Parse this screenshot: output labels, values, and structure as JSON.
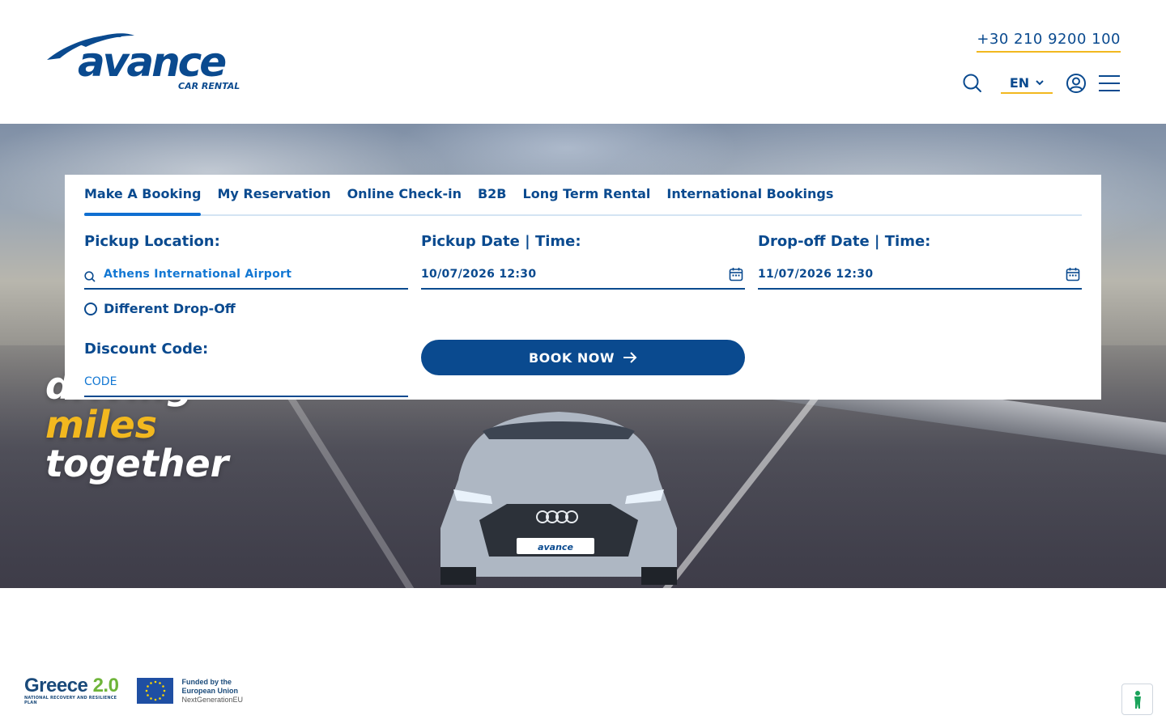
{
  "header": {
    "logo_text": "avance",
    "logo_subtitle": "CAR RENTAL",
    "phone": "+30 210 9200 100",
    "language": "EN"
  },
  "hero": {
    "slogan_line1": "driving",
    "slogan_line2": "miles",
    "slogan_line3": "together",
    "plate_text": "avance"
  },
  "booking": {
    "tabs": [
      {
        "label": "Make A Booking",
        "active": true
      },
      {
        "label": "My Reservation",
        "active": false
      },
      {
        "label": "Online Check-in",
        "active": false
      },
      {
        "label": "B2B",
        "active": false
      },
      {
        "label": "Long Term Rental",
        "active": false
      },
      {
        "label": "International Bookings",
        "active": false
      }
    ],
    "pickup_location_label": "Pickup Location:",
    "pickup_location_value": "Athens International Airport",
    "different_dropoff_label": "Different Drop-Off",
    "discount_label": "Discount Code:",
    "discount_placeholder": "CODE",
    "pickup_date_label": "Pickup Date | Time:",
    "pickup_date_value": "10/07/2026 12:30",
    "dropoff_date_label": "Drop-off Date | Time:",
    "dropoff_date_value": "11/07/2026 12:30",
    "book_label": "BOOK NOW"
  },
  "footer": {
    "greece_title": "Greece",
    "greece_version": "2.0",
    "greece_subtitle": "NATIONAL RECOVERY AND RESILIENCE PLAN",
    "eu_line1": "Funded by the",
    "eu_line2": "European Union",
    "eu_line3": "NextGenerationEU"
  },
  "colors": {
    "brand_blue": "#0a4a8f",
    "accent_yellow": "#f2b81f",
    "link_blue": "#1277d3"
  },
  "icons": [
    "search-icon",
    "chevron-down-icon",
    "user-icon",
    "menu-icon",
    "calendar-icon",
    "arrow-right-icon",
    "accessibility-icon"
  ]
}
